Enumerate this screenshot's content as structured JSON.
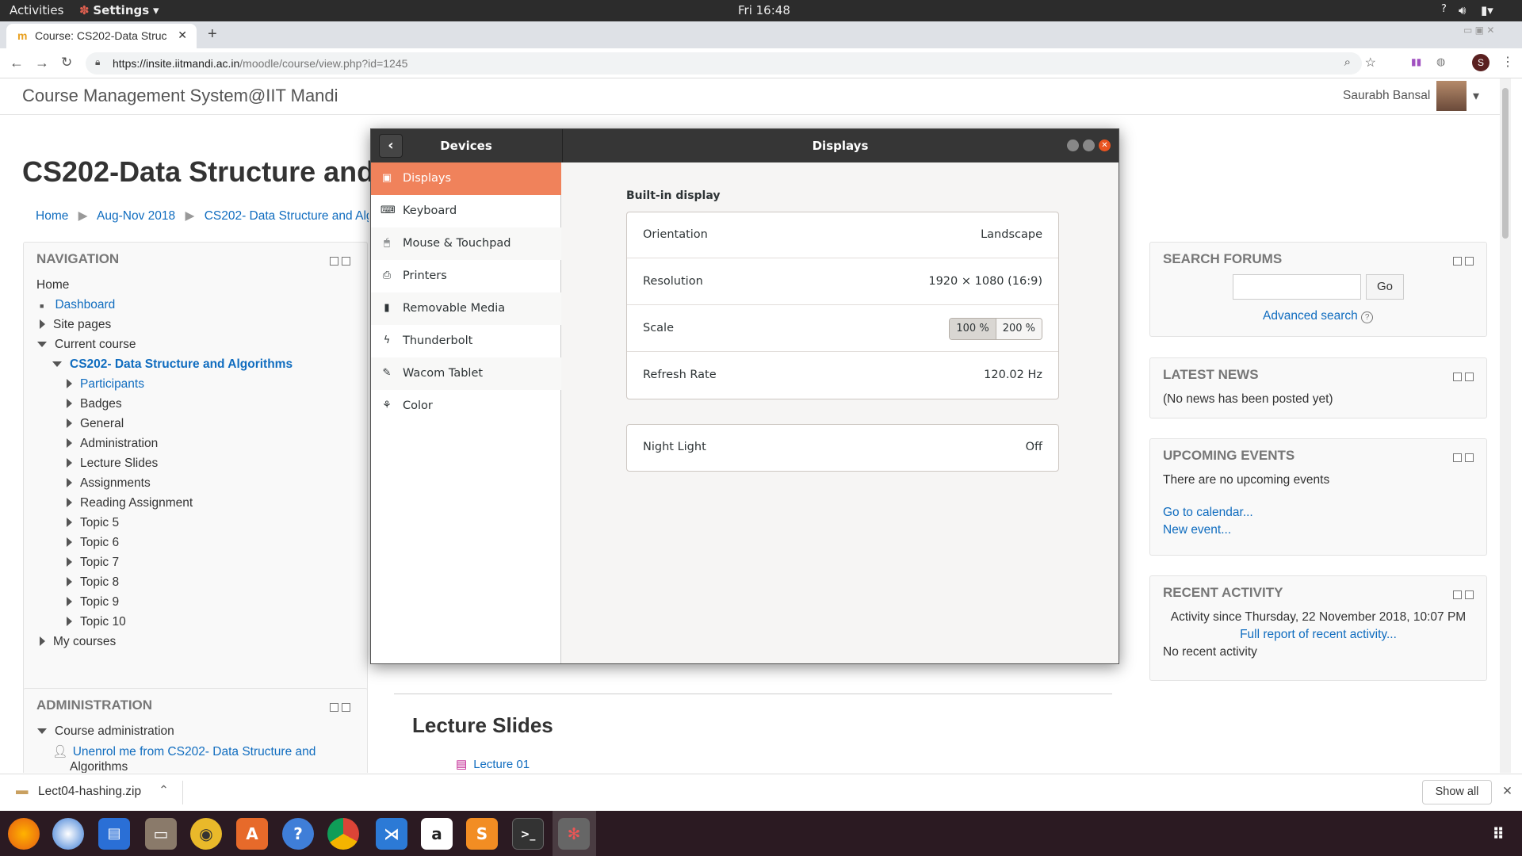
{
  "topbar": {
    "activities": "Activities",
    "app_menu": "Settings",
    "clock": "Fri 16:48",
    "help": "?"
  },
  "browser": {
    "tab_title": "Course: CS202-Data Struc",
    "new_tab": "+",
    "url_host": "https://insite.iitmandi.ac.in",
    "url_path": "/moodle/course/view.php?id=1245",
    "profile_letter": "S"
  },
  "site": {
    "title": "Course Management System@IIT Mandi",
    "user": "Saurabh Bansal"
  },
  "course": {
    "heading": "CS202-Data Structure and",
    "breadcrumb": [
      "Home",
      "Aug-Nov 2018",
      "CS202- Data Structure and Algor"
    ]
  },
  "navigation": {
    "title": "NAVIGATION",
    "home": "Home",
    "dashboard": "Dashboard",
    "site_pages": "Site pages",
    "current_course": "Current course",
    "course": "CS202- Data Structure and Algorithms",
    "participants": "Participants",
    "items": [
      "Badges",
      "General",
      "Administration",
      "Lecture Slides",
      "Assignments",
      "Reading Assignment",
      "Topic 5",
      "Topic 6",
      "Topic 7",
      "Topic 8",
      "Topic 9",
      "Topic 10"
    ],
    "my_courses": "My courses"
  },
  "administration": {
    "title": "ADMINISTRATION",
    "course_admin": "Course administration",
    "unenrol": "Unenrol me from CS202- Data Structure and",
    "unenrol2": "Algorithms"
  },
  "search_forums": {
    "title": "SEARCH FORUMS",
    "go": "Go",
    "advanced": "Advanced search"
  },
  "latest_news": {
    "title": "LATEST NEWS",
    "text": "(No news has been posted yet)"
  },
  "upcoming": {
    "title": "UPCOMING EVENTS",
    "text": "There are no upcoming events",
    "calendar": "Go to calendar...",
    "new_event": "New event..."
  },
  "recent": {
    "title": "RECENT ACTIVITY",
    "since": "Activity since Thursday, 22 November 2018, 10:07 PM",
    "full": "Full report of recent activity...",
    "none": "No recent activity"
  },
  "main": {
    "section": "Lecture Slides",
    "lecture": "Lecture 01"
  },
  "settings": {
    "sidebar_title": "Devices",
    "panel_title": "Displays",
    "sidebar": [
      {
        "label": "Displays",
        "icon": "display-icon"
      },
      {
        "label": "Keyboard",
        "icon": "keyboard-icon"
      },
      {
        "label": "Mouse & Touchpad",
        "icon": "mouse-icon"
      },
      {
        "label": "Printers",
        "icon": "printer-icon"
      },
      {
        "label": "Removable Media",
        "icon": "usb-icon"
      },
      {
        "label": "Thunderbolt",
        "icon": "thunderbolt-icon"
      },
      {
        "label": "Wacom Tablet",
        "icon": "tablet-icon"
      },
      {
        "label": "Color",
        "icon": "color-icon"
      }
    ],
    "section": "Built-in display",
    "orientation_label": "Orientation",
    "orientation": "Landscape",
    "resolution_label": "Resolution",
    "resolution": "1920 × 1080 (16:9)",
    "scale_label": "Scale",
    "scale_options": [
      "100 %",
      "200 %"
    ],
    "refresh_label": "Refresh Rate",
    "refresh": "120.02 Hz",
    "night_label": "Night Light",
    "night": "Off",
    "accent": "#f0825b"
  },
  "downloads": {
    "file": "Lect04-hashing.zip",
    "show_all": "Show all"
  },
  "dock": {
    "icons": [
      "firefox-icon",
      "thunderbird-icon",
      "writer-icon",
      "files-icon",
      "rhythmbox-icon",
      "software-icon",
      "help-icon",
      "chrome-icon",
      "vscode-icon",
      "amazon-icon",
      "sublime-icon",
      "terminal-icon",
      "settings-icon",
      "app-grid-icon"
    ]
  }
}
